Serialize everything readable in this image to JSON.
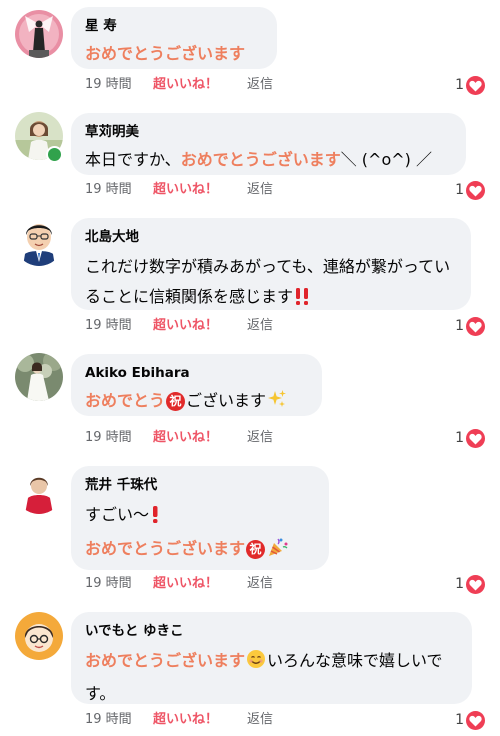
{
  "colors": {
    "highlight": "#ee7f5e",
    "super_like": "#ee5566",
    "bubble_bg": "#f0f2f5",
    "meta_text": "#65676b",
    "heart_red": "#ef3e55",
    "online_green": "#31a24c"
  },
  "actions": {
    "like_label": "超いいね！",
    "reply_label": "返信"
  },
  "comments": [
    {
      "author": "星 寿",
      "text_highlight": "おめでとうございます",
      "time": "19 時間",
      "reaction_count": "1",
      "reaction_icon": "heart-icon"
    },
    {
      "author": "草苅明美",
      "text_prefix": "本日ですか、",
      "text_highlight": "おめでとうございます",
      "text_suffix": "＼ (^o^) ／",
      "time": "19 時間",
      "reaction_count": "1",
      "online": true
    },
    {
      "author": "北島大地",
      "text": "これだけ数字が積みあがっても、連絡が繋がっていることに信頼関係を感じます",
      "emoji": "double-exclamation-icon",
      "time": "19 時間",
      "reaction_count": "1"
    },
    {
      "author": "Akiko Ebihara",
      "text_highlight": "おめでとう",
      "iwai_badge": "祝",
      "text_suffix": "ございます",
      "emoji": "sparkles-icon",
      "time": "19 時間",
      "reaction_count": "1"
    },
    {
      "author": "荒井 千珠代",
      "line1": "すごい〜",
      "line1_emoji": "exclamation-icon",
      "text_highlight": "おめでとうございます",
      "iwai_badge": "祝",
      "emoji": "party-popper-icon",
      "time": "19 時間",
      "reaction_count": "1"
    },
    {
      "author": "いでもと ゆきこ",
      "text_highlight": "おめでとうございます",
      "emoji": "smiling-face-icon",
      "text_suffix": "いろんな意味で嬉しいです。",
      "time": "19 時間",
      "reaction_count": "1"
    }
  ]
}
